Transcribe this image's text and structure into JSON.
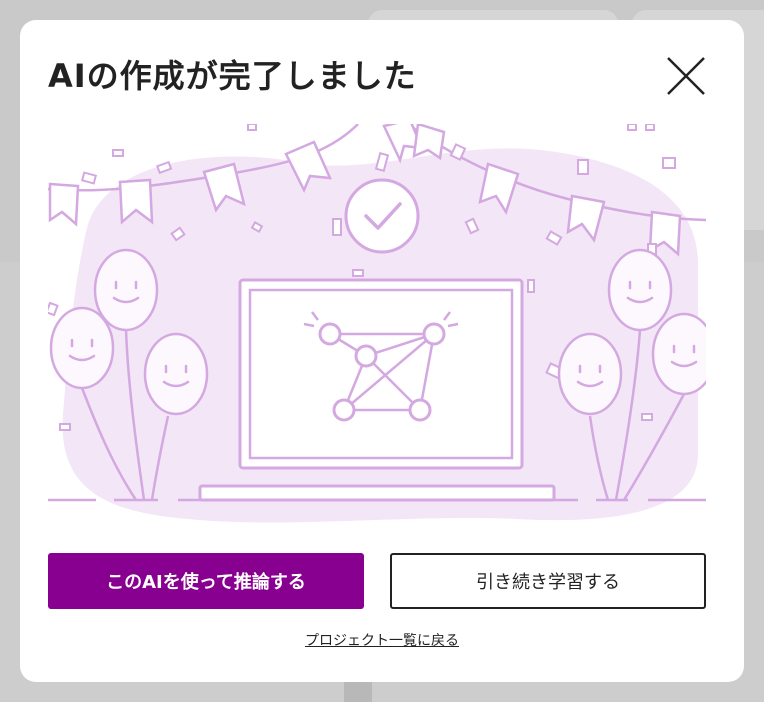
{
  "modal": {
    "title": "AIの作成が完了しました",
    "close_icon": "close-icon",
    "illustration": "celebration-laptop-network-illustration",
    "primary_button": "このAIを使って推論する",
    "secondary_button": "引き続き学習する",
    "back_link": "プロジェクト一覧に戻る"
  },
  "colors": {
    "primary": "#870090",
    "illustration_stroke": "#d4a8e0",
    "illustration_fill": "#f3e6f7",
    "text": "#222222"
  }
}
